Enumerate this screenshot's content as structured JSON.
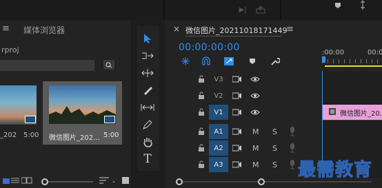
{
  "top_strip": {},
  "project_panel": {
    "menu_glyph": "≡",
    "tab_label": "媒体浏览器",
    "path_fragment": "rproj",
    "clips": [
      {
        "name": "_202",
        "duration": "5:00"
      },
      {
        "name": "微信图片_202...",
        "duration": "5:00"
      }
    ]
  },
  "timeline": {
    "close_glyph": "×",
    "sequence_name": "微信图片_20211018171449",
    "menu_glyph": "≡",
    "timecode": "00:00:00:00",
    "ruler_labels": [
      ":00:00",
      "00:0"
    ],
    "tracks": [
      {
        "id": "V3",
        "active": false,
        "type": "video"
      },
      {
        "id": "V2",
        "active": false,
        "type": "video"
      },
      {
        "id": "V1",
        "active": true,
        "type": "video"
      },
      {
        "id": "A1",
        "active": true,
        "type": "audio"
      },
      {
        "id": "A2",
        "active": true,
        "type": "audio"
      },
      {
        "id": "A3",
        "active": true,
        "type": "audio"
      }
    ],
    "mute_label": "M",
    "solo_label": "S",
    "clip_label": "微信图片_20..."
  },
  "watermark": "最需教育",
  "colors": {
    "accent": "#2d8ceb",
    "track_active": "#1f4f7a",
    "clip_pink": "#e7a0d8",
    "playhead": "#3a90e6",
    "work_area": "#e0e036"
  }
}
